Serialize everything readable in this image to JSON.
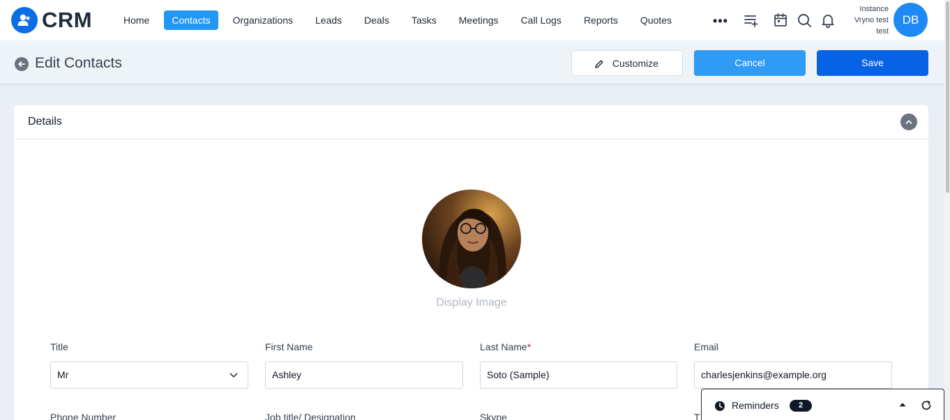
{
  "app": {
    "name": "CRM"
  },
  "nav": {
    "items": [
      {
        "label": "Home"
      },
      {
        "label": "Contacts",
        "active": true
      },
      {
        "label": "Organizations"
      },
      {
        "label": "Leads"
      },
      {
        "label": "Deals"
      },
      {
        "label": "Tasks"
      },
      {
        "label": "Meetings"
      },
      {
        "label": "Call Logs"
      },
      {
        "label": "Reports"
      },
      {
        "label": "Quotes"
      }
    ],
    "more_label": "•••",
    "icons": [
      "list-add-icon",
      "calendar-icon",
      "search-icon",
      "bell-icon"
    ]
  },
  "user": {
    "instance_line1": "Instance",
    "instance_line2": "Vryno test",
    "instance_line3": "test",
    "initials": "DB"
  },
  "page": {
    "title": "Edit Contacts",
    "customize_label": "Customize",
    "cancel_label": "Cancel",
    "save_label": "Save"
  },
  "section": {
    "title": "Details",
    "display_image_caption": "Display Image"
  },
  "form": {
    "title": {
      "label": "Title",
      "value": "Mr"
    },
    "first_name": {
      "label": "First Name",
      "value": "Ashley"
    },
    "last_name": {
      "label": "Last Name",
      "required_mark": "*",
      "value": "Soto (Sample)"
    },
    "email": {
      "label": "Email",
      "value": "charlesjenkins@example.org"
    },
    "phone": {
      "label": "Phone Number"
    },
    "job_title": {
      "label": "Job title/ Designation"
    },
    "skype": {
      "label": "Skype"
    },
    "fourth_label": "T"
  },
  "reminders": {
    "label": "Reminders",
    "count": "2"
  },
  "colors": {
    "primary": "#0763e5",
    "accent": "#2196f3",
    "text": "#1f2937"
  }
}
